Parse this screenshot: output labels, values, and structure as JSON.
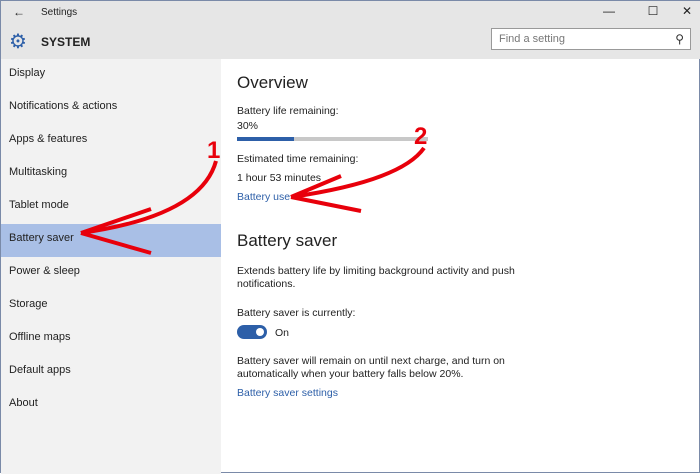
{
  "window": {
    "title": "Settings",
    "back": "←",
    "minimize": "—",
    "maximize": "☐",
    "close": "✕"
  },
  "header": {
    "title": "SYSTEM",
    "search_placeholder": "Find a setting"
  },
  "sidebar": {
    "items": [
      {
        "label": "Display"
      },
      {
        "label": "Notifications & actions"
      },
      {
        "label": "Apps & features"
      },
      {
        "label": "Multitasking"
      },
      {
        "label": "Tablet mode"
      },
      {
        "label": "Battery saver",
        "selected": true
      },
      {
        "label": "Power & sleep"
      },
      {
        "label": "Storage"
      },
      {
        "label": "Offline maps"
      },
      {
        "label": "Default apps"
      },
      {
        "label": "About"
      }
    ]
  },
  "overview": {
    "heading": "Overview",
    "battery_label": "Battery life remaining:",
    "battery_value": "30%",
    "battery_percent": 30,
    "time_label": "Estimated time remaining:",
    "time_value": "1 hour 53 minutes",
    "battery_use_link": "Battery use"
  },
  "battery_saver": {
    "heading": "Battery saver",
    "description": "Extends battery life by limiting background activity and push notifications.",
    "status_label": "Battery saver is currently:",
    "toggle_state": "On",
    "note": "Battery saver will remain on until next charge, and turn on automatically when your battery falls below 20%.",
    "settings_link": "Battery saver settings"
  },
  "annotations": {
    "one": "1",
    "two": "2",
    "color": "#e8000b"
  }
}
